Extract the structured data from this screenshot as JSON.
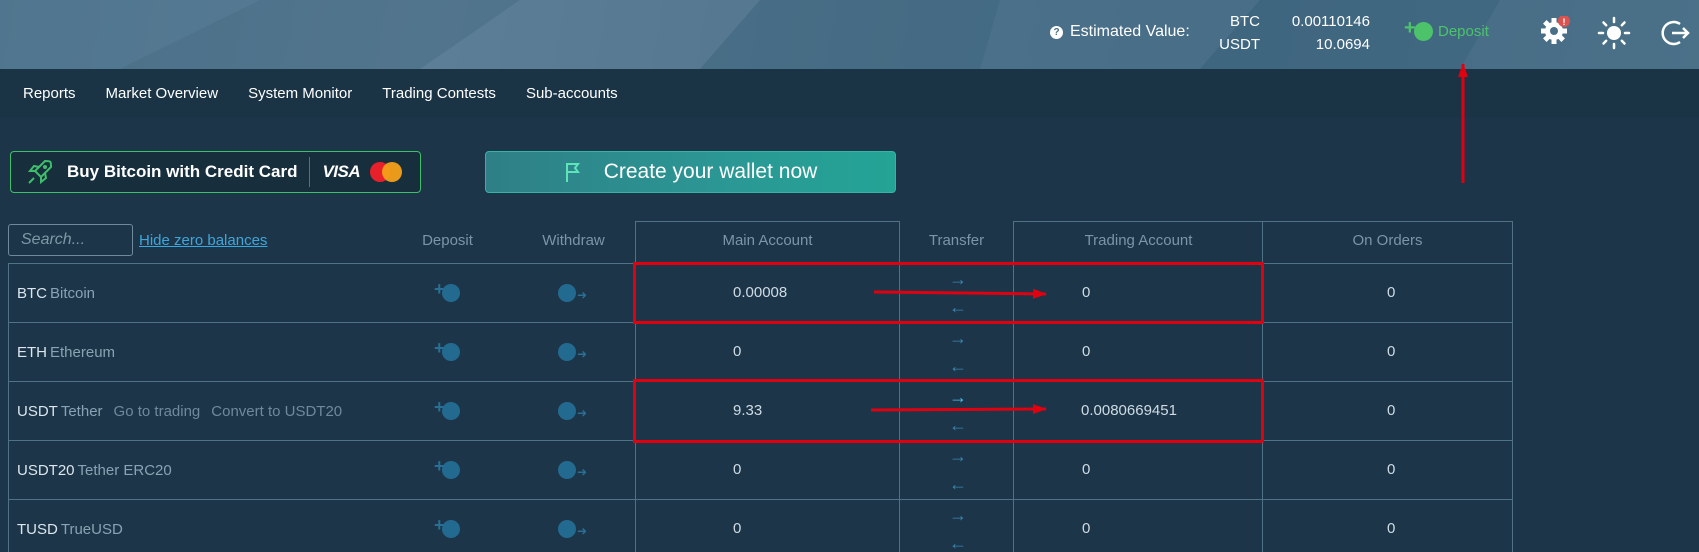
{
  "header": {
    "estimated_label": "Estimated Value:",
    "estimates": [
      {
        "currency": "BTC",
        "value": "0.00110146"
      },
      {
        "currency": "USDT",
        "value": "10.0694"
      }
    ],
    "deposit_label": "Deposit",
    "settings_badge": "!"
  },
  "nav": {
    "items": [
      "Reports",
      "Market Overview",
      "System Monitor",
      "Trading Contests",
      "Sub-accounts"
    ]
  },
  "banners": {
    "buy_label": "Buy Bitcoin with Credit Card",
    "visa_label": "VISA",
    "wallet_label": "Create your wallet now"
  },
  "toolbar": {
    "search_placeholder": "Search...",
    "hide_zero": "Hide zero balances"
  },
  "columns": {
    "deposit": "Deposit",
    "withdraw": "Withdraw",
    "main_account": "Main Account",
    "transfer": "Transfer",
    "trading_account": "Trading Account",
    "on_orders": "On Orders"
  },
  "rows": [
    {
      "ticker": "BTC",
      "name": "Bitcoin",
      "links": [],
      "main": "0.00008",
      "trading": "0",
      "orders": "0",
      "highlight": true
    },
    {
      "ticker": "ETH",
      "name": "Ethereum",
      "links": [],
      "main": "0",
      "trading": "0",
      "orders": "0",
      "highlight": false
    },
    {
      "ticker": "USDT",
      "name": "Tether",
      "links": [
        "Go to trading",
        "Convert to USDT20"
      ],
      "main": "9.33",
      "trading": "0.0080669451",
      "orders": "0",
      "highlight": true
    },
    {
      "ticker": "USDT20",
      "name": "Tether ERC20",
      "links": [],
      "main": "0",
      "trading": "0",
      "orders": "0",
      "highlight": false
    },
    {
      "ticker": "TUSD",
      "name": "TrueUSD",
      "links": [],
      "main": "0",
      "trading": "0",
      "orders": "0",
      "highlight": false
    }
  ],
  "colors": {
    "accent_green": "#4cc36b",
    "link_blue": "#3fa6dc",
    "annotation_red": "#e10010"
  }
}
